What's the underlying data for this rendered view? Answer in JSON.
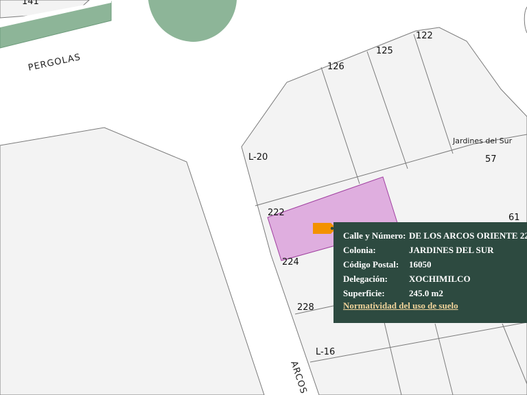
{
  "colors": {
    "lot_fill": "#f3f3f3",
    "selected_fill": "#dfaedf",
    "selected_stroke": "#a040a0",
    "park_green": "#8db598",
    "popup_bg": "#2d4a40",
    "marker": "#f39200"
  },
  "map": {
    "street_labels": {
      "pergolas": "PERGOLAS",
      "arcos": "ARCOS"
    },
    "colonia_label": "Jardines del Sur",
    "lot_numbers": {
      "n141": "141",
      "n122": "122",
      "n125": "125",
      "n126": "126",
      "n57": "57",
      "n61": "61",
      "n6x": "6",
      "l20": "L-20",
      "n222": "222",
      "n224": "224",
      "n228": "228",
      "l16": "L-16"
    }
  },
  "popup": {
    "rows": [
      {
        "key": "Calle y Número:",
        "value": "DE LOS ARCOS ORIENTE 22"
      },
      {
        "key": "Colonia:",
        "value": "JARDINES DEL SUR"
      },
      {
        "key": "Código Postal:",
        "value": "16050"
      },
      {
        "key": "Delegación:",
        "value": "XOCHIMILCO"
      },
      {
        "key": "Superficie:",
        "value": "245.0 m2"
      }
    ],
    "link": "Normatividad del uso de suelo"
  },
  "marker_icon": "tag-marker-icon"
}
